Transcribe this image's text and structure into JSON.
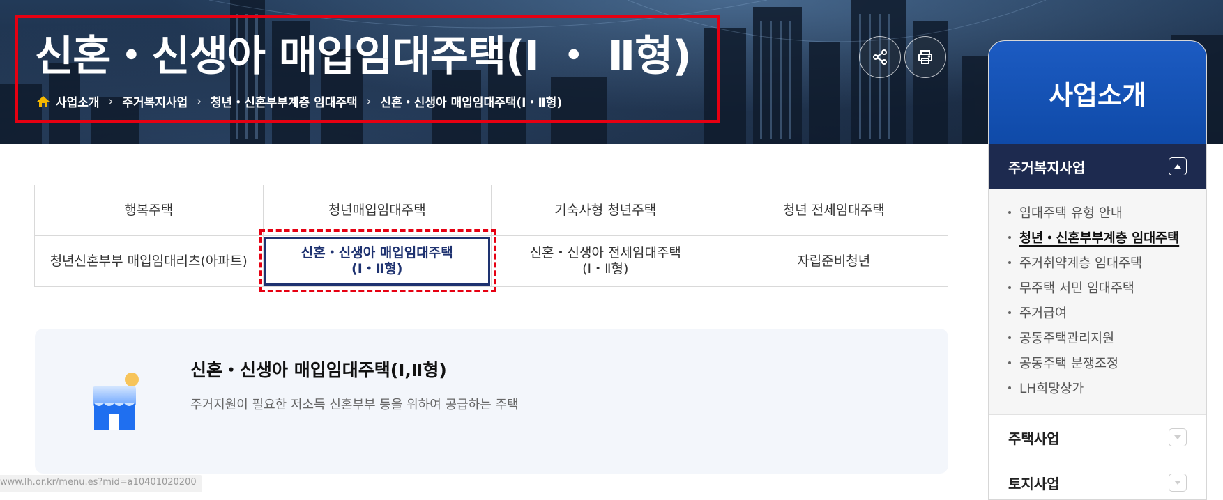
{
  "hero": {
    "title": "신혼・신생아 매입임대주택(Ⅰ ・ Ⅱ형)",
    "breadcrumb": [
      "사업소개",
      "주거복지사업",
      "청년・신혼부부계층 임대주택",
      "신혼・신생아 매입임대주택(Ⅰ・Ⅱ형)"
    ],
    "separator": "›",
    "icons": {
      "home": "home-icon",
      "share": "share-icon",
      "print": "print-icon"
    }
  },
  "tabs": {
    "row1": [
      "행복주택",
      "청년매입임대주택",
      "기숙사형 청년주택",
      "청년 전세임대주택"
    ],
    "row2": [
      {
        "line1": "청년신혼부부 매입임대리츠(아파트)",
        "line2": ""
      },
      {
        "line1": "신혼・신생아 매입임대주택",
        "line2": "(Ⅰ・Ⅱ형)"
      },
      {
        "line1": "신혼・신생아 전세임대주택",
        "line2": "(Ⅰ・Ⅱ형)"
      },
      {
        "line1": "자립준비청년",
        "line2": ""
      }
    ],
    "active_color": "#1e3270"
  },
  "info": {
    "title": "신혼・신생아 매입임대주택(Ⅰ,Ⅱ형)",
    "description": "주거지원이 필요한 저소득 신혼부부 등을 위하여 공급하는 주택",
    "icon": "store-icon"
  },
  "sidebar": {
    "header": "사업소개",
    "open_section": "주거복지사업",
    "items": [
      "임대주택 유형 안내",
      "청년・신혼부부계층 임대주택",
      "주거취약계층 임대주택",
      "무주택 서민 임대주택",
      "주거급여",
      "공동주택관리지원",
      "공동주택 분쟁조정",
      "LH희망상가"
    ],
    "current_item": "청년・신혼부부계층 임대주택",
    "sections": [
      "주택사업",
      "토지사업"
    ]
  },
  "status_bar": {
    "url": "www.lh.or.kr/menu.es?mid=a10401020200"
  },
  "colors": {
    "highlight": "#e60012",
    "navy": "#1d2a4f",
    "blue": "#1c5bc2"
  }
}
